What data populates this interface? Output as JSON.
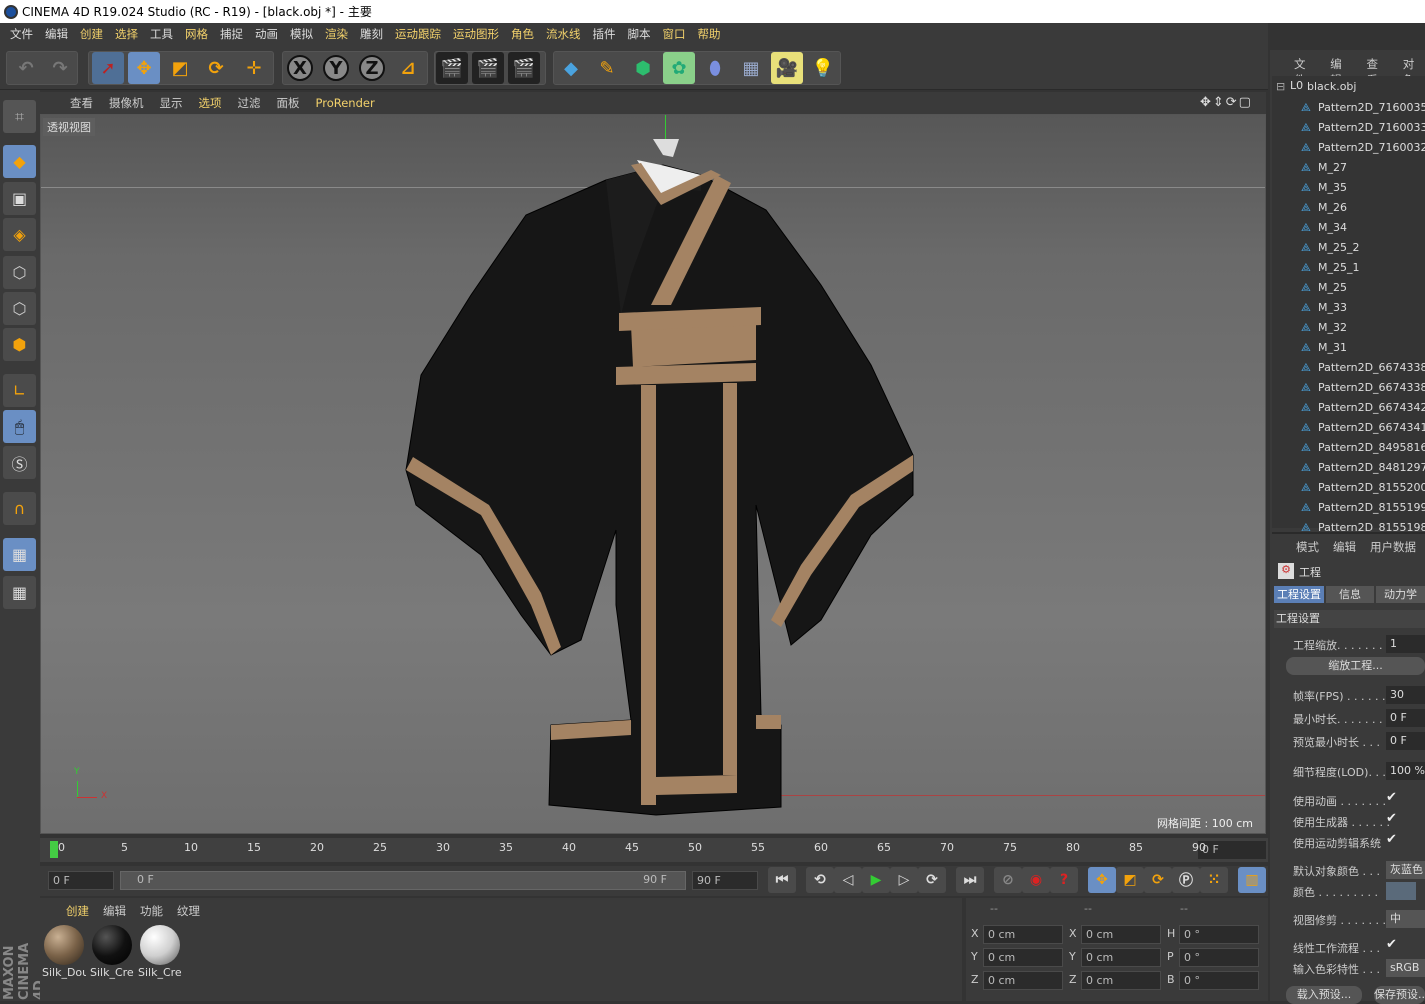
{
  "window_title": "CINEMA 4D R19.024 Studio (RC - R19) - [black.obj *] - 主要",
  "menu": [
    "文件",
    "编辑",
    "创建",
    "选择",
    "工具",
    "网格",
    "捕捉",
    "动画",
    "模拟",
    "渲染",
    "雕刻",
    "运动跟踪",
    "运动图形",
    "角色",
    "流水线",
    "插件",
    "脚本",
    "窗口",
    "帮助"
  ],
  "viewport": {
    "menu": [
      "查看",
      "摄像机",
      "显示",
      "选项",
      "过滤",
      "面板",
      "ProRender"
    ],
    "label": "透视视图",
    "grid_spacing": "网格间距 : 100 cm",
    "axis_x": "X",
    "axis_y": "Y"
  },
  "timeline": {
    "ticks": [
      "0",
      "5",
      "10",
      "15",
      "20",
      "25",
      "30",
      "35",
      "40",
      "45",
      "50",
      "55",
      "60",
      "65",
      "70",
      "75",
      "80",
      "85",
      "90"
    ],
    "frame_field": "0 F"
  },
  "controls": {
    "start": "0 F",
    "range_left": "0 F",
    "range_right": "90 F",
    "end": "90 F"
  },
  "materials": {
    "menu": [
      "创建",
      "编辑",
      "功能",
      "纹理"
    ],
    "items": [
      {
        "name": "Silk_Dou",
        "color": "#7a6248"
      },
      {
        "name": "Silk_Cre",
        "color": "#111111"
      },
      {
        "name": "Silk_Cre",
        "color": "#cfcfcf"
      }
    ]
  },
  "coords": {
    "headers": [
      "--",
      "--",
      "--"
    ],
    "rows": [
      {
        "a": "X",
        "av": "0 cm",
        "b": "X",
        "bv": "0 cm",
        "c": "H",
        "cv": "0 °"
      },
      {
        "a": "Y",
        "av": "0 cm",
        "b": "Y",
        "bv": "0 cm",
        "c": "P",
        "cv": "0 °"
      },
      {
        "a": "Z",
        "av": "0 cm",
        "b": "Z",
        "bv": "0 cm",
        "c": "B",
        "cv": "0 °"
      }
    ]
  },
  "object_manager": {
    "menu": [
      "文件",
      "编辑",
      "查看",
      "对象"
    ],
    "root": "black.obj",
    "items": [
      "Pattern2D_7160035",
      "Pattern2D_7160033",
      "Pattern2D_7160032",
      "M_27",
      "M_35",
      "M_26",
      "M_34",
      "M_25_2",
      "M_25_1",
      "M_25",
      "M_33",
      "M_32",
      "M_31",
      "Pattern2D_6674338_",
      "Pattern2D_6674338",
      "Pattern2D_6674342",
      "Pattern2D_6674341",
      "Pattern2D_8495816",
      "Pattern2D_8481297",
      "Pattern2D_8155200",
      "Pattern2D_8155199",
      "Pattern2D_8155198"
    ]
  },
  "attributes": {
    "menu": [
      "模式",
      "编辑",
      "用户数据"
    ],
    "object": "工程",
    "tabs": [
      "工程设置",
      "信息",
      "动力学"
    ],
    "section": "工程设置",
    "project_scale_label": "工程缩放. . . . . . . . .",
    "project_scale_value": "1",
    "scale_button": "缩放工程...",
    "fps_label": "帧率(FPS) . . . . . . .",
    "fps_value": "30",
    "min_time_label": "最小时长. . . . . . . . .",
    "min_time_value": "0 F",
    "preview_min_label": "预览最小时长 . . .",
    "preview_min_value": "0 F",
    "lod_label": "细节程度(LOD). . .",
    "lod_value": "100 %",
    "use_anim_label": "使用动画 . . . . . . .",
    "use_gen_label": "使用生成器 . . . . . .",
    "use_motion_label": "使用运动剪辑系统",
    "default_color_label": "默认对象颜色 . . .",
    "default_color_value": "灰蓝色",
    "color_label": "颜色 . . . . . . . . .",
    "view_clip_label": "视图修剪 . . . . . . .",
    "view_clip_value": "中",
    "linear_label": "线性工作流程 . . .",
    "input_color_label": "输入色彩特性 . . .",
    "input_color_value": "sRGB",
    "load_preset": "载入预设...",
    "save_preset": "保存预设..."
  },
  "brand": "MAXON CINEMA 4D"
}
